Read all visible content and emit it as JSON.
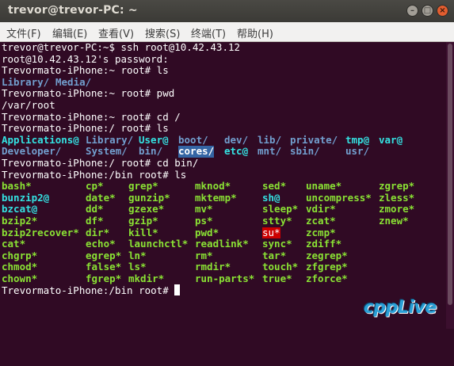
{
  "window": {
    "title": "trevor@trevor-PC: ~",
    "buttons": {
      "minimize": "–",
      "maximize": "□",
      "close": "×"
    }
  },
  "menu": [
    "文件(F)",
    "编辑(E)",
    "查看(V)",
    "搜索(S)",
    "终端(T)",
    "帮助(H)"
  ],
  "terminal": {
    "lines": [
      "trevor@trevor-PC:~$ ssh root@10.42.43.12",
      "root@10.42.43.12's password:",
      "Trevormato-iPhone:~ root# ls",
      "Trevormato-iPhone:~ root# pwd",
      "/var/root",
      "Trevormato-iPhone:~ root# cd /",
      "Trevormato-iPhone:/ root# ls",
      "Trevormato-iPhone:/ root# cd bin/",
      "Trevormato-iPhone:/bin root# ls",
      "Trevormato-iPhone:/bin root#"
    ],
    "home_ls": [
      "Library/",
      "Media/"
    ],
    "root_ls": [
      [
        "Applications@",
        "Library/",
        "User@",
        "boot/",
        "dev/",
        "lib/",
        "private/",
        "tmp@",
        "var@"
      ],
      [
        "Developer/",
        "System/",
        "bin/",
        "cores/",
        "etc@",
        "mnt/",
        "sbin/",
        "usr/"
      ]
    ],
    "bin_ls": [
      [
        "bash*",
        "cp*",
        "grep*",
        "mknod*",
        "sed*",
        "uname*",
        "zgrep*"
      ],
      [
        "bunzip2@",
        "date*",
        "gunzip*",
        "mktemp*",
        "sh@",
        "uncompress*",
        "zless*"
      ],
      [
        "bzcat@",
        "dd*",
        "gzexe*",
        "mv*",
        "sleep*",
        "vdir*",
        "zmore*"
      ],
      [
        "bzip2*",
        "df*",
        "gzip*",
        "ps*",
        "stty*",
        "zcat*",
        "znew*"
      ],
      [
        "bzip2recover*",
        "dir*",
        "kill*",
        "pwd*",
        "su*",
        "zcmp*"
      ],
      [
        "cat*",
        "echo*",
        "launchctl*",
        "readlink*",
        "sync*",
        "zdiff*"
      ],
      [
        "chgrp*",
        "egrep*",
        "ln*",
        "rm*",
        "tar*",
        "zegrep*"
      ],
      [
        "chmod*",
        "false*",
        "ls*",
        "rmdir*",
        "touch*",
        "zfgrep*"
      ],
      [
        "chown*",
        "fgrep*",
        "mkdir*",
        "run-parts*",
        "true*",
        "zforce*"
      ]
    ]
  },
  "watermark": "cppLive",
  "colors": {
    "background": "#300a24",
    "directory": "#729fcf",
    "executable": "#8ae234",
    "symlink": "#34e2e2",
    "setuid": "#cc0000",
    "sticky_dir": "#3465a4"
  }
}
